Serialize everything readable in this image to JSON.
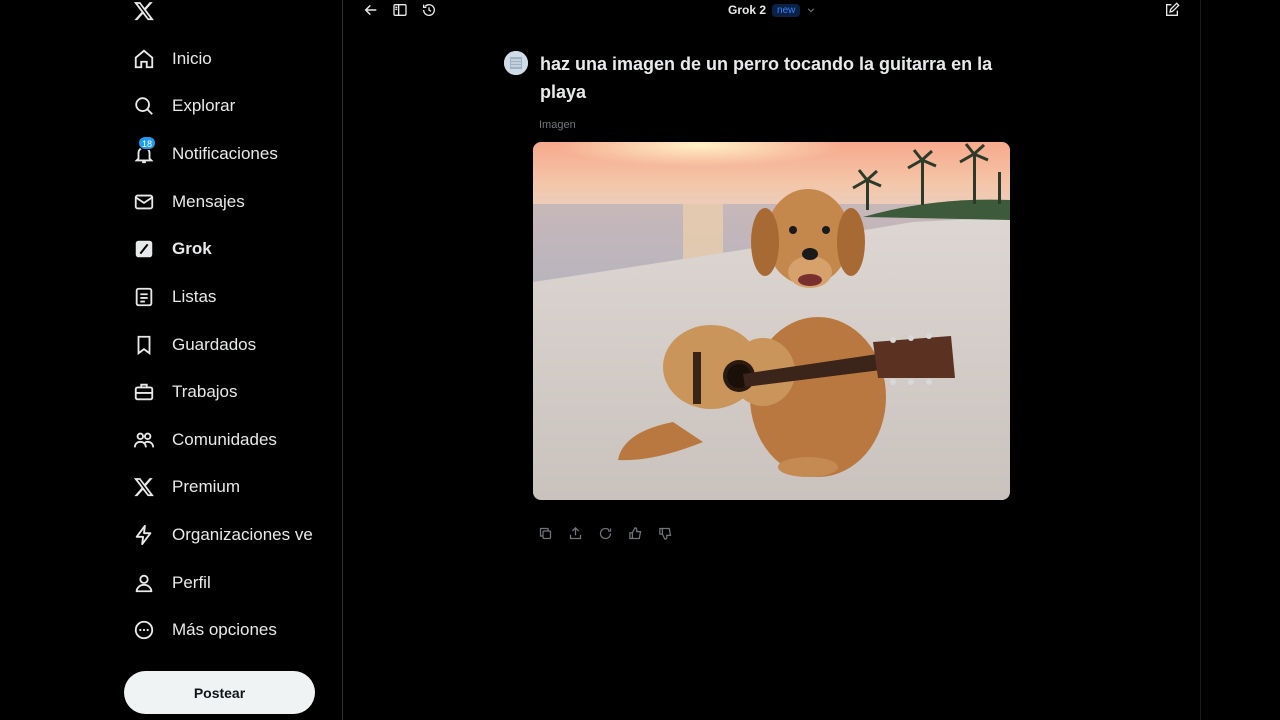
{
  "sidebar": {
    "items": [
      {
        "label": "Inicio",
        "icon": "home-icon"
      },
      {
        "label": "Explorar",
        "icon": "search-icon"
      },
      {
        "label": "Notificaciones",
        "icon": "bell-icon",
        "badge": "18"
      },
      {
        "label": "Mensajes",
        "icon": "envelope-icon"
      },
      {
        "label": "Grok",
        "icon": "grok-icon"
      },
      {
        "label": "Listas",
        "icon": "list-icon"
      },
      {
        "label": "Guardados",
        "icon": "bookmark-icon"
      },
      {
        "label": "Trabajos",
        "icon": "briefcase-icon"
      },
      {
        "label": "Comunidades",
        "icon": "people-icon"
      },
      {
        "label": "Premium",
        "icon": "x-logo-icon"
      },
      {
        "label": "Organizaciones verificadas",
        "icon": "lightning-icon"
      },
      {
        "label": "Perfil",
        "icon": "person-icon"
      },
      {
        "label": "Más opciones",
        "icon": "more-circle-icon"
      }
    ],
    "post_label": "Postear"
  },
  "topbar": {
    "model_name": "Grok 2",
    "new_badge": "new"
  },
  "chat": {
    "prompt": "haz una imagen de un perro tocando la guitarra en la playa",
    "image_label": "Imagen"
  },
  "colors": {
    "background": "#000000",
    "accent": "#1d9bf0",
    "post_button": "#eff3f4"
  }
}
